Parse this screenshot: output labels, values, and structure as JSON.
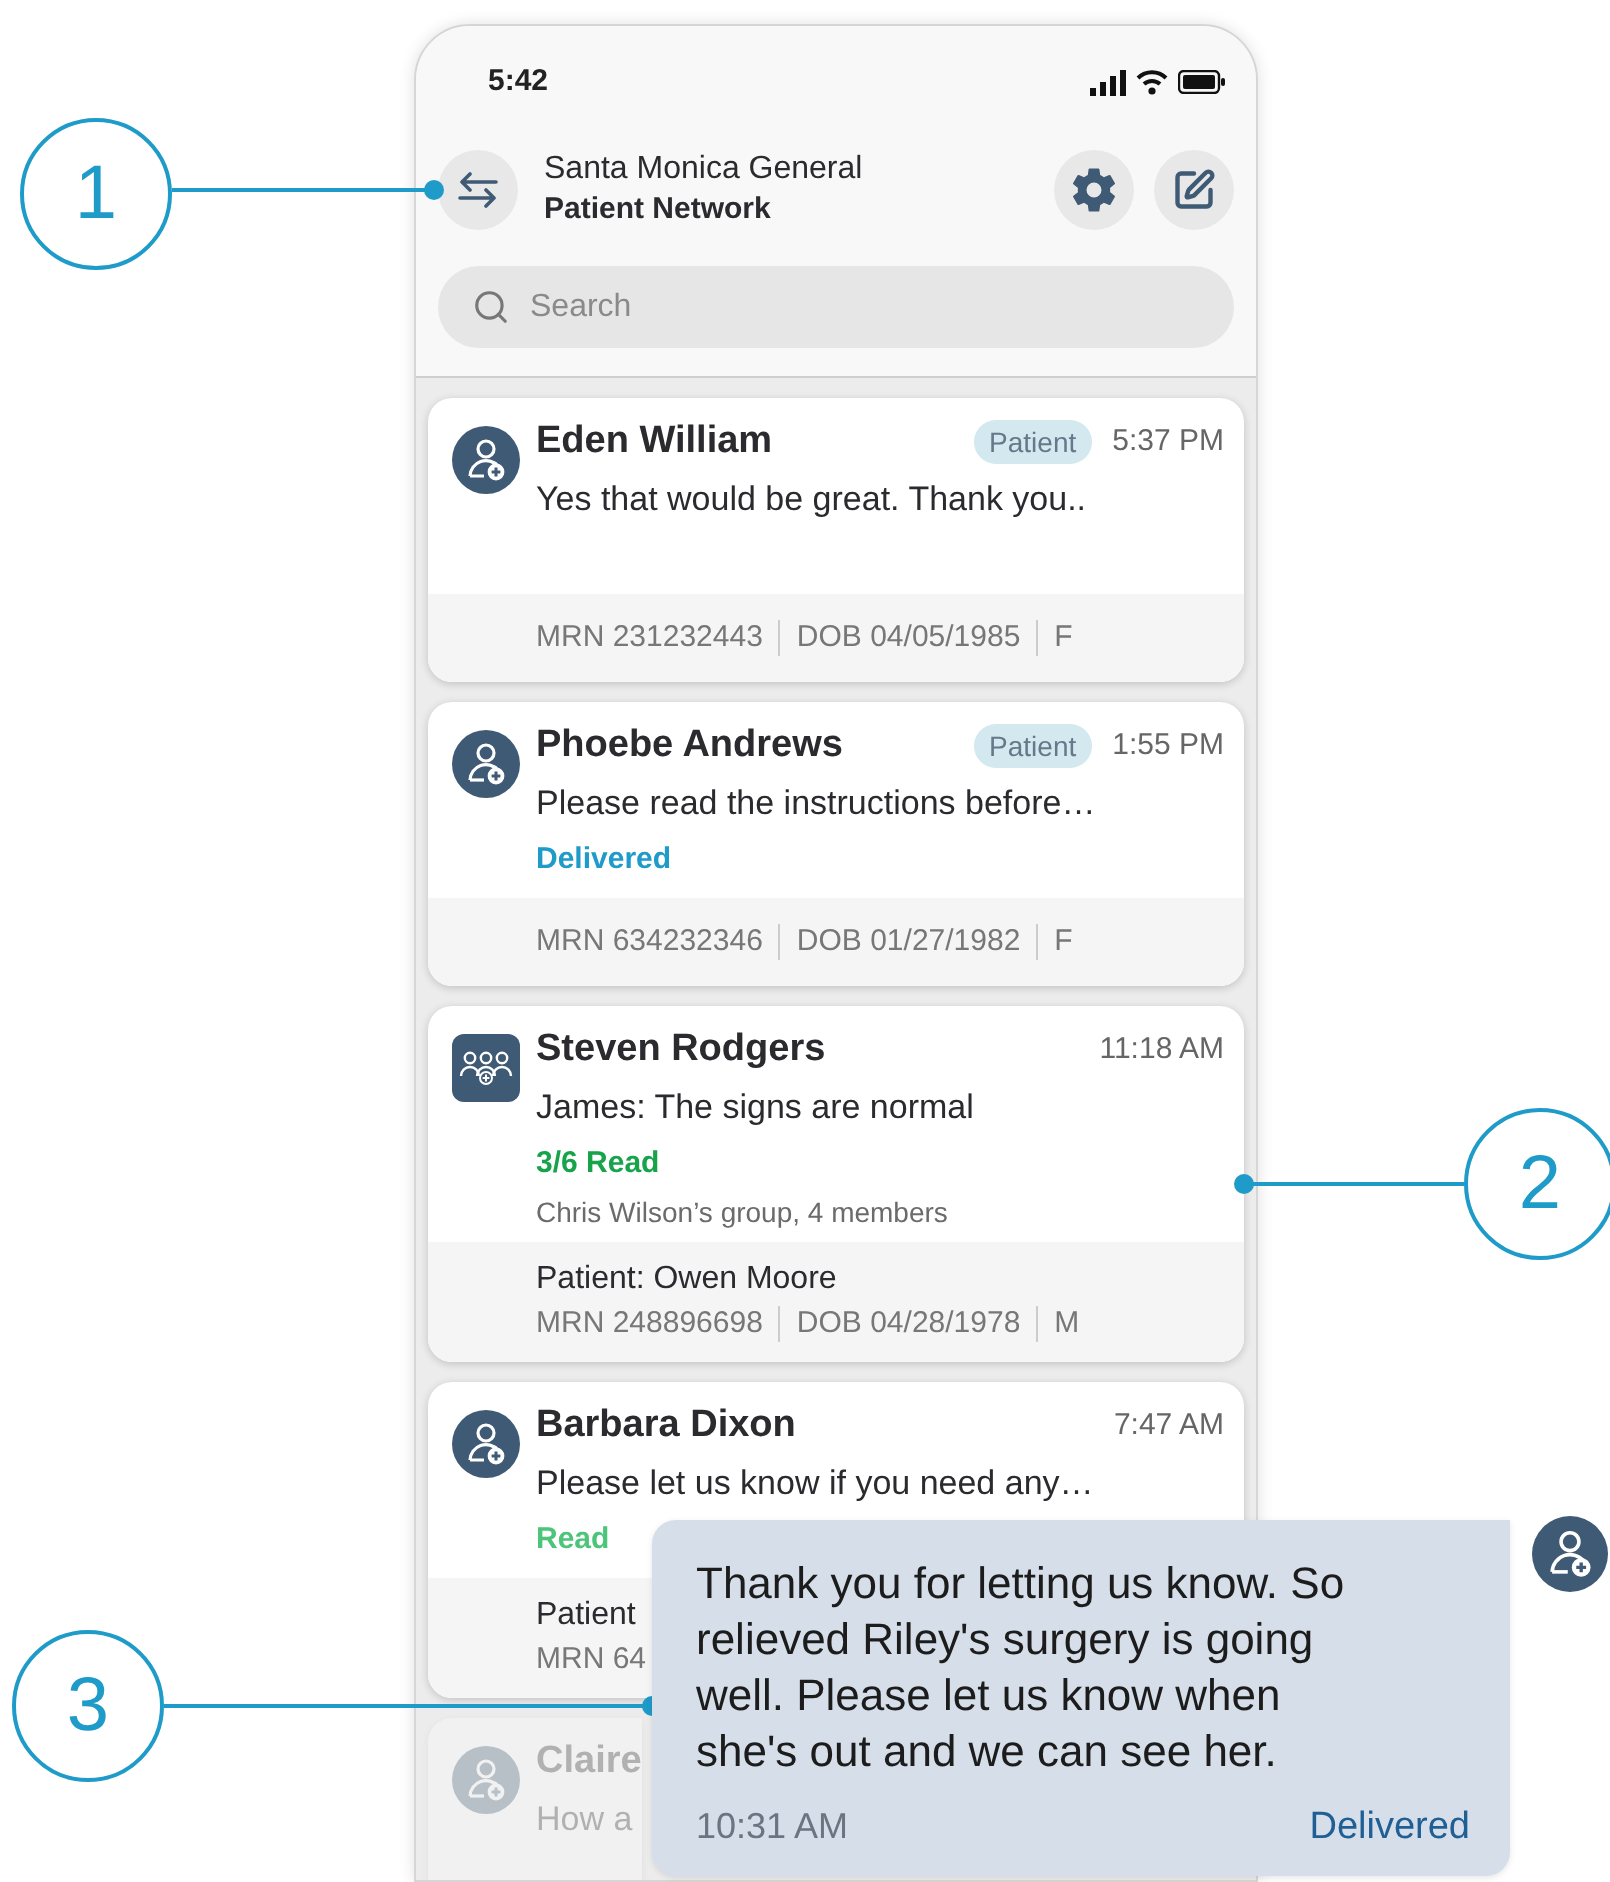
{
  "status_bar": {
    "time": "5:42"
  },
  "header": {
    "title": "Santa Monica General",
    "subtitle": "Patient Network"
  },
  "search": {
    "placeholder": "Search"
  },
  "conversations": [
    {
      "kind": "patient",
      "name": "Eden William",
      "tag": "Patient",
      "time": "5:37 PM",
      "message": "Yes that would be great. Thank you..",
      "footer": {
        "mrn": "MRN 231232443",
        "dob": "DOB 04/05/1985",
        "sex": "F"
      },
      "faded": false
    },
    {
      "kind": "patient",
      "name": "Phoebe Andrews",
      "tag": "Patient",
      "time": "1:55 PM",
      "message": "Please read the instructions before…",
      "status": {
        "kind": "delivered",
        "text": "Delivered"
      },
      "footer": {
        "mrn": "MRN 634232346",
        "dob": "DOB 01/27/1982",
        "sex": "F"
      },
      "faded": false
    },
    {
      "kind": "group",
      "name": "Steven Rodgers",
      "time": "11:18 AM",
      "message": "James: The signs are normal",
      "status": {
        "kind": "read_count",
        "text": "3/6 Read"
      },
      "group_info": "Chris Wilson’s group, 4 members",
      "footer": {
        "patient": "Patient: Owen Moore",
        "mrn": "MRN 248896698",
        "dob": "DOB 04/28/1978",
        "sex": "M"
      },
      "faded": false
    },
    {
      "kind": "patient",
      "name": "Barbara Dixon",
      "time": "7:47 AM",
      "message": "Please let us know if you need any…",
      "status": {
        "kind": "read",
        "text": "Read"
      },
      "footer": {
        "patient": "Patient",
        "mrn": "MRN 64"
      },
      "faded": false
    },
    {
      "kind": "patient",
      "name": "Claire",
      "message": "How a",
      "faded": true
    }
  ],
  "bubble": {
    "message": "Thank you for letting us know. So relieved Riley's surgery is going well. Please let us know when she's out and we can see her.",
    "time": "10:31 AM",
    "status": "Delivered"
  },
  "callouts": [
    {
      "label": "1"
    },
    {
      "label": "2"
    },
    {
      "label": "3"
    }
  ]
}
